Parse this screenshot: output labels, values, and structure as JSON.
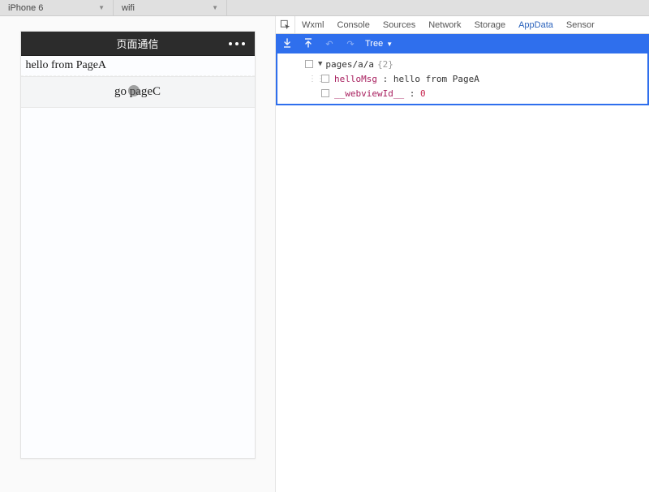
{
  "topbar": {
    "device": "iPhone 6",
    "network": "wifi"
  },
  "simulator": {
    "title": "页面通信",
    "message": "hello from PageA",
    "button_label": "go pageC"
  },
  "devtools": {
    "tabs": [
      "Wxml",
      "Console",
      "Sources",
      "Network",
      "Storage",
      "AppData",
      "Sensor"
    ],
    "active_tab": "AppData",
    "toolbar": {
      "view_mode": "Tree"
    },
    "tree": {
      "root_path": "pages/a/a",
      "root_count": "{2}",
      "items": [
        {
          "key": "helloMsg",
          "value": "hello from PageA",
          "type": "string"
        },
        {
          "key": "__webviewId__",
          "value": "0",
          "type": "number"
        }
      ]
    }
  }
}
